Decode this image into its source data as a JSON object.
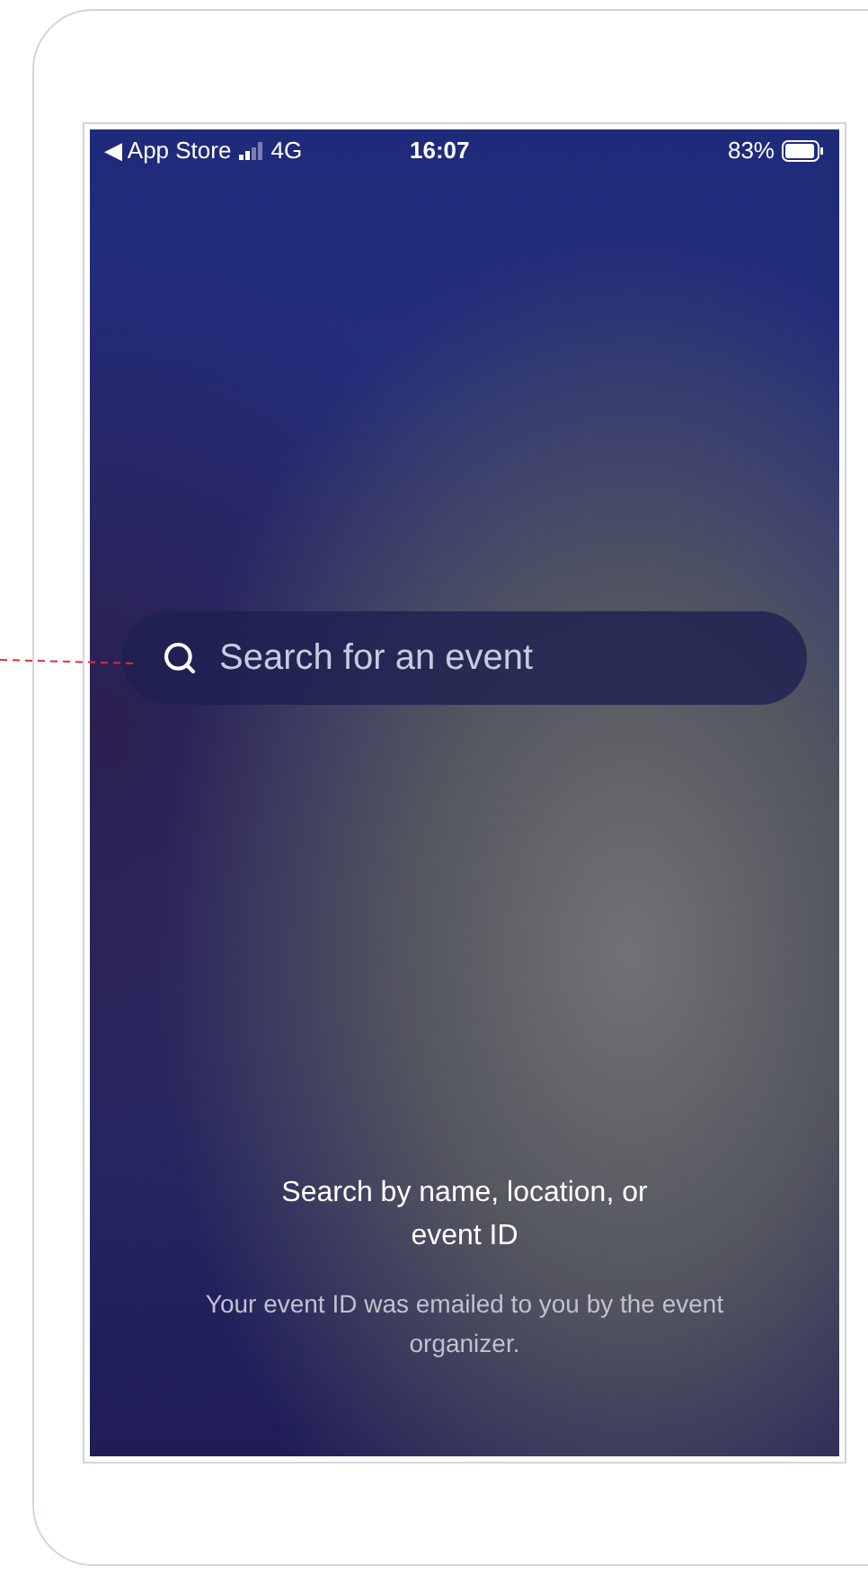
{
  "status_bar": {
    "back_label": "◀ App Store",
    "network": "4G",
    "time": "16:07",
    "battery": "83%"
  },
  "search": {
    "placeholder": "Search for an event"
  },
  "hint": {
    "title": "Search by name, location, or event ID",
    "description": "Your event ID was emailed to you by the event organizer."
  }
}
